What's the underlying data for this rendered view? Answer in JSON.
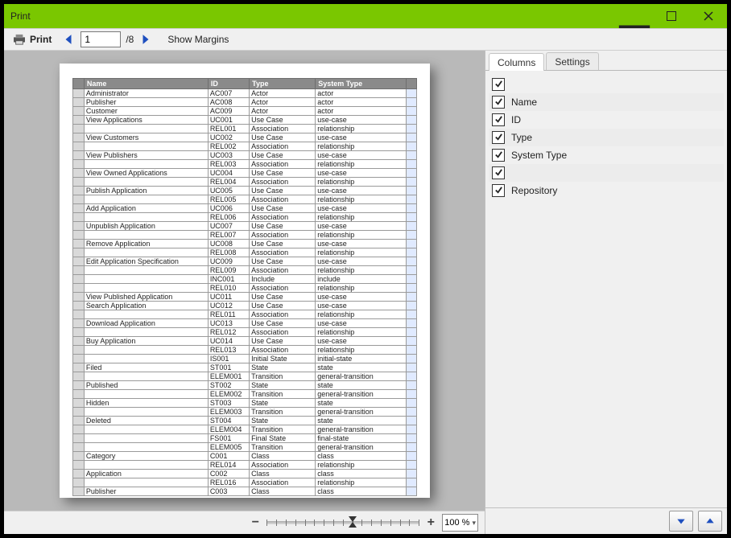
{
  "window": {
    "title": "Print"
  },
  "toolbar": {
    "print_label": "Print",
    "page_current": "1",
    "page_total_label": "/8",
    "show_margins_label": "Show Margins"
  },
  "zoom": {
    "value": "100 %"
  },
  "side": {
    "tabs": [
      "Columns",
      "Settings"
    ],
    "columns": [
      {
        "label": "",
        "checked": true
      },
      {
        "label": "Name",
        "checked": true
      },
      {
        "label": "ID",
        "checked": true
      },
      {
        "label": "Type",
        "checked": true
      },
      {
        "label": "System Type",
        "checked": true
      },
      {
        "label": "",
        "checked": true
      },
      {
        "label": "Repository",
        "checked": true
      }
    ]
  },
  "preview": {
    "headers": [
      "",
      "Name",
      "ID",
      "Type",
      "System Type",
      ""
    ],
    "rows": [
      {
        "name": "Administrator",
        "id": "AC007",
        "type": "Actor",
        "sys": "actor"
      },
      {
        "name": "Publisher",
        "id": "AC008",
        "type": "Actor",
        "sys": "actor"
      },
      {
        "name": "Customer",
        "id": "AC009",
        "type": "Actor",
        "sys": "actor"
      },
      {
        "name": "View Applications",
        "id": "UC001",
        "type": "Use Case",
        "sys": "use-case"
      },
      {
        "name": "",
        "id": "REL001",
        "type": "Association",
        "sys": "relationship"
      },
      {
        "name": "View Customers",
        "id": "UC002",
        "type": "Use Case",
        "sys": "use-case"
      },
      {
        "name": "",
        "id": "REL002",
        "type": "Association",
        "sys": "relationship"
      },
      {
        "name": "View Publishers",
        "id": "UC003",
        "type": "Use Case",
        "sys": "use-case"
      },
      {
        "name": "",
        "id": "REL003",
        "type": "Association",
        "sys": "relationship"
      },
      {
        "name": "View Owned Applications",
        "id": "UC004",
        "type": "Use Case",
        "sys": "use-case"
      },
      {
        "name": "",
        "id": "REL004",
        "type": "Association",
        "sys": "relationship"
      },
      {
        "name": "Publish Application",
        "id": "UC005",
        "type": "Use Case",
        "sys": "use-case"
      },
      {
        "name": "",
        "id": "REL005",
        "type": "Association",
        "sys": "relationship"
      },
      {
        "name": "Add Application",
        "id": "UC006",
        "type": "Use Case",
        "sys": "use-case"
      },
      {
        "name": "",
        "id": "REL006",
        "type": "Association",
        "sys": "relationship"
      },
      {
        "name": "Unpublish Application",
        "id": "UC007",
        "type": "Use Case",
        "sys": "use-case"
      },
      {
        "name": "",
        "id": "REL007",
        "type": "Association",
        "sys": "relationship"
      },
      {
        "name": "Remove Application",
        "id": "UC008",
        "type": "Use Case",
        "sys": "use-case"
      },
      {
        "name": "",
        "id": "REL008",
        "type": "Association",
        "sys": "relationship"
      },
      {
        "name": "Edit Application Specification",
        "id": "UC009",
        "type": "Use Case",
        "sys": "use-case"
      },
      {
        "name": "",
        "id": "REL009",
        "type": "Association",
        "sys": "relationship"
      },
      {
        "name": "",
        "id": "INC001",
        "type": "Include",
        "sys": "include"
      },
      {
        "name": "",
        "id": "REL010",
        "type": "Association",
        "sys": "relationship"
      },
      {
        "name": "View Published Application",
        "id": "UC011",
        "type": "Use Case",
        "sys": "use-case"
      },
      {
        "name": "Search Application",
        "id": "UC012",
        "type": "Use Case",
        "sys": "use-case"
      },
      {
        "name": "",
        "id": "REL011",
        "type": "Association",
        "sys": "relationship"
      },
      {
        "name": "Download Application",
        "id": "UC013",
        "type": "Use Case",
        "sys": "use-case"
      },
      {
        "name": "",
        "id": "REL012",
        "type": "Association",
        "sys": "relationship"
      },
      {
        "name": "Buy Application",
        "id": "UC014",
        "type": "Use Case",
        "sys": "use-case"
      },
      {
        "name": "",
        "id": "REL013",
        "type": "Association",
        "sys": "relationship"
      },
      {
        "name": "",
        "id": "IS001",
        "type": "Initial State",
        "sys": "initial-state"
      },
      {
        "name": "Filed",
        "id": "ST001",
        "type": "State",
        "sys": "state"
      },
      {
        "name": "",
        "id": "ELEM001",
        "type": "Transition",
        "sys": "general-transition"
      },
      {
        "name": "Published",
        "id": "ST002",
        "type": "State",
        "sys": "state"
      },
      {
        "name": "",
        "id": "ELEM002",
        "type": "Transition",
        "sys": "general-transition"
      },
      {
        "name": "Hidden",
        "id": "ST003",
        "type": "State",
        "sys": "state"
      },
      {
        "name": "",
        "id": "ELEM003",
        "type": "Transition",
        "sys": "general-transition"
      },
      {
        "name": "Deleted",
        "id": "ST004",
        "type": "State",
        "sys": "state"
      },
      {
        "name": "",
        "id": "ELEM004",
        "type": "Transition",
        "sys": "general-transition"
      },
      {
        "name": "",
        "id": "FS001",
        "type": "Final State",
        "sys": "final-state"
      },
      {
        "name": "",
        "id": "ELEM005",
        "type": "Transition",
        "sys": "general-transition"
      },
      {
        "name": "Category",
        "id": "C001",
        "type": "Class",
        "sys": "class"
      },
      {
        "name": "",
        "id": "REL014",
        "type": "Association",
        "sys": "relationship"
      },
      {
        "name": "Application",
        "id": "C002",
        "type": "Class",
        "sys": "class"
      },
      {
        "name": "",
        "id": "REL016",
        "type": "Association",
        "sys": "relationship"
      },
      {
        "name": "Publisher",
        "id": "C003",
        "type": "Class",
        "sys": "class"
      }
    ]
  }
}
